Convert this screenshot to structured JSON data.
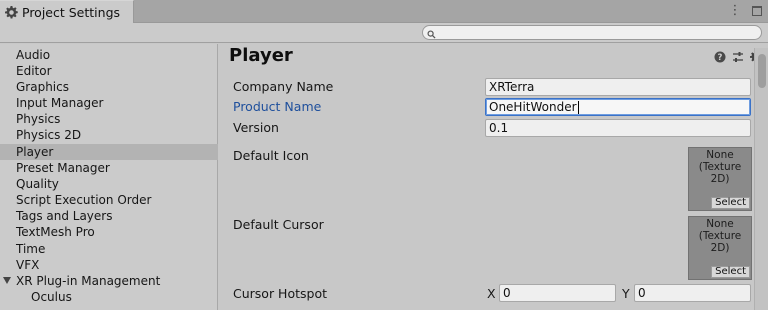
{
  "window": {
    "title": "Project Settings",
    "menu_glyph": "⋮"
  },
  "search": {
    "placeholder": "",
    "value": ""
  },
  "sidebar": {
    "items": [
      {
        "label": "Audio",
        "selected": false
      },
      {
        "label": "Editor",
        "selected": false
      },
      {
        "label": "Graphics",
        "selected": false
      },
      {
        "label": "Input Manager",
        "selected": false
      },
      {
        "label": "Physics",
        "selected": false
      },
      {
        "label": "Physics 2D",
        "selected": false
      },
      {
        "label": "Player",
        "selected": true
      },
      {
        "label": "Preset Manager",
        "selected": false
      },
      {
        "label": "Quality",
        "selected": false
      },
      {
        "label": "Script Execution Order",
        "selected": false
      },
      {
        "label": "Tags and Layers",
        "selected": false
      },
      {
        "label": "TextMesh Pro",
        "selected": false
      },
      {
        "label": "Time",
        "selected": false
      },
      {
        "label": "VFX",
        "selected": false
      },
      {
        "label": "XR Plug-in Management",
        "selected": false,
        "expanded": true
      },
      {
        "label": "Oculus",
        "selected": false,
        "child": true
      }
    ]
  },
  "main": {
    "title": "Player",
    "header_icons": [
      "help-icon",
      "preset-sliders-icon",
      "settings-gear-icon"
    ],
    "fields": {
      "company_name": {
        "label": "Company Name",
        "value": "XRTerra"
      },
      "product_name": {
        "label": "Product Name",
        "value": "OneHitWonder"
      },
      "version": {
        "label": "Version",
        "value": "0.1"
      },
      "default_icon": {
        "label": "Default Icon",
        "none_text": "None",
        "type_text": "(Texture 2D)",
        "select_label": "Select"
      },
      "default_cursor": {
        "label": "Default Cursor",
        "none_text": "None",
        "type_text": "(Texture 2D)",
        "select_label": "Select"
      },
      "cursor_hotspot": {
        "label": "Cursor Hotspot",
        "x_label": "X",
        "x_value": "0",
        "y_label": "Y",
        "y_value": "0"
      }
    }
  },
  "colors": {
    "focus_label": "#1e4f9c",
    "focus_border": "#3a72c8",
    "selected_row": "#b3b3b3",
    "panel_bg": "#c8c8c8",
    "texture_slot": "#8a8a8a"
  }
}
